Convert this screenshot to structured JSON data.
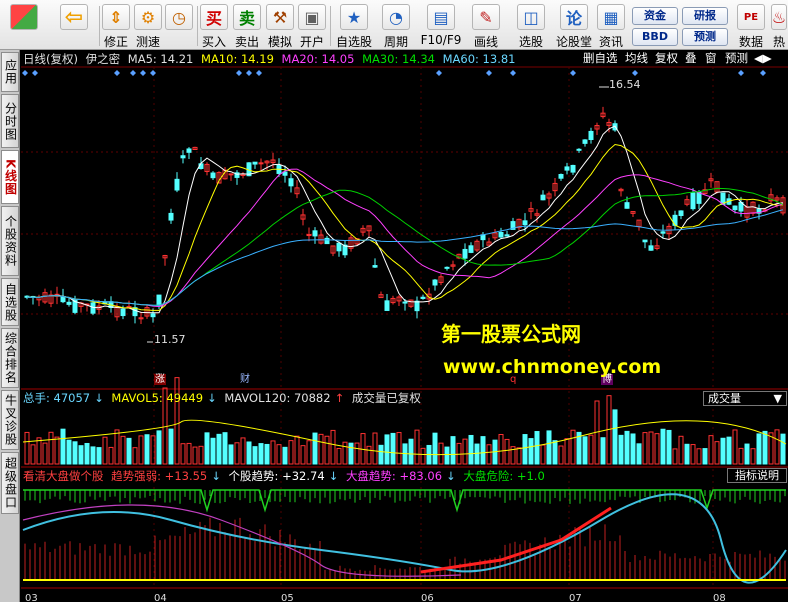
{
  "toolbar": {
    "buttons": [
      {
        "label": "",
        "icon": "grid-icon"
      },
      {
        "label": "",
        "icon": "back-arrow-icon"
      },
      {
        "label": "修正",
        "icon": "fix-icon"
      },
      {
        "label": "测速",
        "icon": "speed-icon"
      },
      {
        "label": "买入",
        "icon": "buy-icon"
      },
      {
        "label": "卖出",
        "icon": "sell-icon"
      },
      {
        "label": "模拟",
        "icon": "hammer-icon"
      },
      {
        "label": "开户",
        "icon": "lock-icon"
      },
      {
        "label": "自选股",
        "icon": "star-icon"
      },
      {
        "label": "周期",
        "icon": "clock-icon"
      },
      {
        "label": "F10/F9",
        "icon": "f10-icon"
      },
      {
        "label": "画线",
        "icon": "pencil-icon"
      },
      {
        "label": "选股",
        "icon": "select-stock-icon"
      },
      {
        "label": "论股堂",
        "icon": "forum-icon"
      },
      {
        "label": "资讯",
        "icon": "news-icon"
      },
      {
        "label": "数据",
        "icon": "pe-data-icon"
      },
      {
        "label": "热",
        "icon": "hot-icon"
      }
    ],
    "glyphs": {
      "buy": "买",
      "sell": "卖",
      "forum": "论",
      "pe": "PE"
    },
    "pills": [
      "资金",
      "研报",
      "BBD",
      "预测"
    ]
  },
  "sidebar": {
    "tabs": [
      "应用",
      "分时图",
      "K线图",
      "个股资料",
      "自选股",
      "综合排名",
      "牛叉诊股",
      "超级盘口"
    ],
    "active_index": 2
  },
  "header": {
    "title": "日线(复权)",
    "stock": "伊之密",
    "ma5": "MA5: 14.21",
    "ma10": "MA10: 14.19",
    "ma20": "MA20: 14.05",
    "ma30": "MA30: 14.34",
    "ma60": "MA60: 13.81",
    "right_buttons": [
      "删自选",
      "均线",
      "复权",
      "叠",
      "窗",
      "预测"
    ]
  },
  "price_panel": {
    "high_label": "16.54",
    "low_label": "11.57",
    "event_tags": [
      "涨",
      "财",
      "q",
      "博"
    ]
  },
  "volume_header": {
    "total": "总手: 47057",
    "mavol5": "MAVOL5: 49449",
    "mavol120": "MAVOL120: 70882",
    "note": "成交量已复权",
    "dropdown": "成交量"
  },
  "indicator_header": {
    "name": "看清大盘做个股",
    "trend_strength": "趋势强弱: +13.55",
    "stock_trend": "个股趋势: +32.74",
    "market_trend": "大盘趋势: +83.06",
    "market_risk": "大盘危险: +1.0",
    "button": "指标说明"
  },
  "watermark": {
    "line1": "第一股票公式网",
    "line2": "www.chnmoney.com"
  },
  "x_axis": [
    "03",
    "04",
    "05",
    "06",
    "07",
    "08"
  ],
  "colors": {
    "up": "#ff3232",
    "down": "#54ffff",
    "ma5": "#ffffff",
    "ma10": "#ffff00",
    "ma20": "#ff40ff",
    "ma30": "#00d000",
    "ma60": "#3ab0ff",
    "background": "#000000"
  }
}
